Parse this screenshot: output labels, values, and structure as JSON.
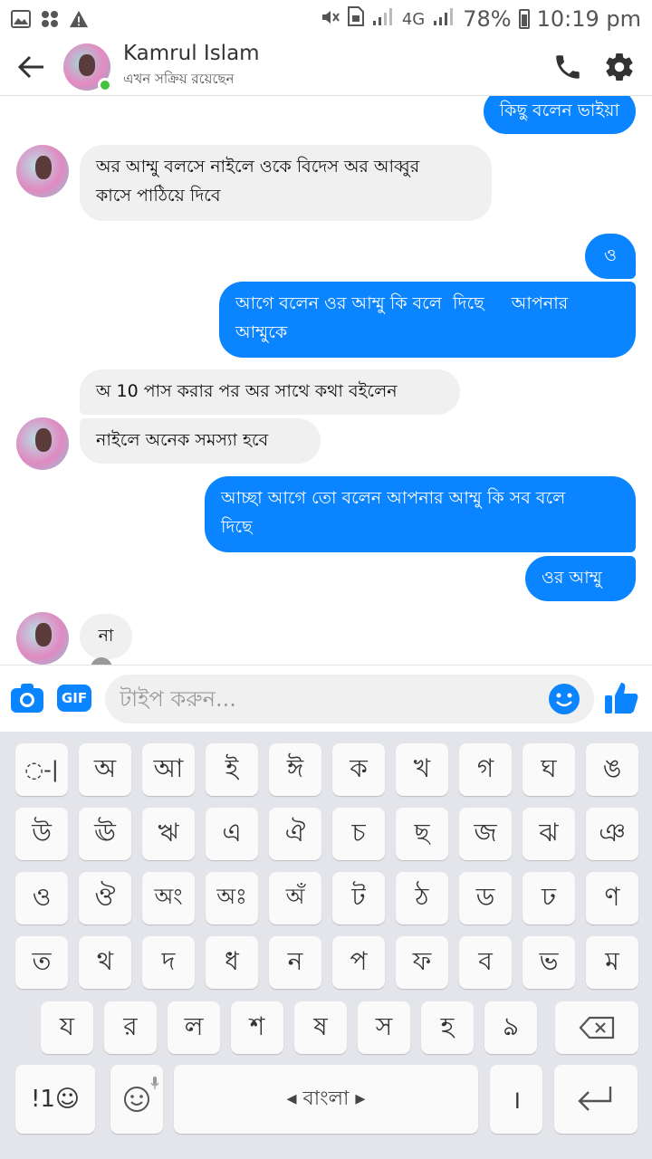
{
  "status_bar": {
    "signal_label": "4G",
    "battery": "78%",
    "time": "10:19 pm"
  },
  "header": {
    "contact_name": "Kamrul Islam",
    "contact_status": "এখন সক্রিয় রয়েছেন"
  },
  "messages": [
    {
      "dir": "out",
      "text": "কিছু বলেন ভাইয়া"
    },
    {
      "dir": "in",
      "text_l1": "অর আম্মু বলসে নাইলে ওকে বিদেস অর আব্বুর",
      "text_l2": "কাসে পাঠিয়ে দিবে"
    },
    {
      "dir": "out",
      "text": "ও"
    },
    {
      "dir": "out",
      "text_l1": "আগে বলেন ওর আম্মু কি বলে  দিছে     আপনার",
      "text_l2": "আম্মুকে"
    },
    {
      "dir": "in",
      "text": "অ 10 পাস করার পর অর সাথে কথা বইলেন"
    },
    {
      "dir": "in",
      "text": "নাইলে অনেক সমস্যা  হবে"
    },
    {
      "dir": "out",
      "text_l1": "আচ্ছা আগে তো বলেন আপনার আম্মু কি সব বলে",
      "text_l2": "দিছে"
    },
    {
      "dir": "out",
      "text": "ওর আম্মু"
    },
    {
      "dir": "in",
      "text": "না"
    }
  ],
  "composer": {
    "placeholder": "টাইপ করুন...",
    "gif_label": "GIF"
  },
  "keyboard": {
    "rows": [
      [
        "◌-|",
        "অ",
        "আ",
        "ই",
        "ঈ",
        "ক",
        "খ",
        "গ",
        "ঘ",
        "ঙ"
      ],
      [
        "উ",
        "ঊ",
        "ঋ",
        "এ",
        "ঐ",
        "চ",
        "ছ",
        "জ",
        "ঝ",
        "ঞ"
      ],
      [
        "ও",
        "ঔ",
        "অং",
        "অঃ",
        "অঁ",
        "ট",
        "ঠ",
        "ড",
        "ঢ",
        "ণ"
      ],
      [
        "ত",
        "থ",
        "দ",
        "ধ",
        "ন",
        "প",
        "ফ",
        "ব",
        "ভ",
        "ম"
      ],
      [
        "য",
        "র",
        "ল",
        "শ",
        "ষ",
        "স",
        "হ",
        "ঌ"
      ]
    ],
    "sym_label": "!1☺",
    "space_label": "◂ বাংলা ▸",
    "danda": "।"
  },
  "colors": {
    "accent": "#0b84ff",
    "incoming": "#f0f0f0",
    "online": "#44c23f"
  }
}
